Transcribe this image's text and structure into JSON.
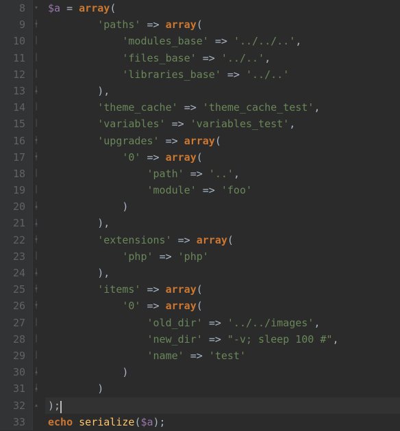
{
  "lines": [
    {
      "num": "8",
      "folds": [
        "open"
      ],
      "tokens": [
        "var:$a",
        " ",
        "punct:= ",
        "kw:array",
        "punct:("
      ]
    },
    {
      "num": "9",
      "folds": [
        "bar",
        "open"
      ],
      "tokens": [
        "indent:8",
        "str:'paths'",
        " ",
        "arrow:=>",
        " ",
        "kw:array",
        "punct:("
      ]
    },
    {
      "num": "10",
      "folds": [
        "bar",
        "bar"
      ],
      "tokens": [
        "indent:12",
        "str:'modules_base'",
        " ",
        "arrow:=>",
        " ",
        "str:'../../..'",
        "punct:,"
      ]
    },
    {
      "num": "11",
      "folds": [
        "bar",
        "bar"
      ],
      "tokens": [
        "indent:12",
        "str:'files_base'",
        " ",
        "arrow:=>",
        " ",
        "str:'../..'",
        "punct:,"
      ]
    },
    {
      "num": "12",
      "folds": [
        "bar",
        "bar"
      ],
      "tokens": [
        "indent:12",
        "str:'libraries_base'",
        " ",
        "arrow:=>",
        " ",
        "str:'../..'"
      ]
    },
    {
      "num": "13",
      "folds": [
        "bar",
        "close"
      ],
      "tokens": [
        "indent:8",
        "punct:)",
        "punct:,"
      ]
    },
    {
      "num": "14",
      "folds": [
        "bar"
      ],
      "tokens": [
        "indent:8",
        "str:'theme_cache'",
        " ",
        "arrow:=>",
        " ",
        "str:'theme_cache_test'",
        "punct:,"
      ]
    },
    {
      "num": "15",
      "folds": [
        "bar"
      ],
      "tokens": [
        "indent:8",
        "str:'variables'",
        " ",
        "arrow:=>",
        " ",
        "str:'variables_test'",
        "punct:,"
      ]
    },
    {
      "num": "16",
      "folds": [
        "bar",
        "open"
      ],
      "tokens": [
        "indent:8",
        "str:'upgrades'",
        " ",
        "arrow:=>",
        " ",
        "kw:array",
        "punct:("
      ]
    },
    {
      "num": "17",
      "folds": [
        "bar",
        "open"
      ],
      "tokens": [
        "indent:12",
        "str:'0'",
        " ",
        "arrow:=>",
        " ",
        "kw:array",
        "punct:("
      ]
    },
    {
      "num": "18",
      "folds": [
        "bar",
        "bar"
      ],
      "tokens": [
        "indent:16",
        "str:'path'",
        " ",
        "arrow:=>",
        " ",
        "str:'..'",
        "punct:,"
      ]
    },
    {
      "num": "19",
      "folds": [
        "bar",
        "bar"
      ],
      "tokens": [
        "indent:16",
        "str:'module'",
        " ",
        "arrow:=>",
        " ",
        "str:'foo'"
      ]
    },
    {
      "num": "20",
      "folds": [
        "bar",
        "close"
      ],
      "tokens": [
        "indent:12",
        "punct:)"
      ]
    },
    {
      "num": "21",
      "folds": [
        "bar",
        "close"
      ],
      "tokens": [
        "indent:8",
        "punct:)",
        "punct:,"
      ]
    },
    {
      "num": "22",
      "folds": [
        "bar",
        "open"
      ],
      "tokens": [
        "indent:8",
        "str:'extensions'",
        " ",
        "arrow:=>",
        " ",
        "kw:array",
        "punct:("
      ]
    },
    {
      "num": "23",
      "folds": [
        "bar",
        "bar"
      ],
      "tokens": [
        "indent:12",
        "str:'php'",
        " ",
        "arrow:=>",
        " ",
        "str:'php'"
      ]
    },
    {
      "num": "24",
      "folds": [
        "bar",
        "close"
      ],
      "tokens": [
        "indent:8",
        "punct:)",
        "punct:,"
      ]
    },
    {
      "num": "25",
      "folds": [
        "bar",
        "open"
      ],
      "tokens": [
        "indent:8",
        "str:'items'",
        " ",
        "arrow:=>",
        " ",
        "kw:array",
        "punct:("
      ]
    },
    {
      "num": "26",
      "folds": [
        "bar",
        "open"
      ],
      "tokens": [
        "indent:12",
        "str:'0'",
        " ",
        "arrow:=>",
        " ",
        "kw:array",
        "punct:("
      ]
    },
    {
      "num": "27",
      "folds": [
        "bar",
        "bar"
      ],
      "tokens": [
        "indent:16",
        "str:'old_dir'",
        " ",
        "arrow:=>",
        " ",
        "str:'../../images'",
        "punct:,"
      ]
    },
    {
      "num": "28",
      "folds": [
        "bar",
        "bar"
      ],
      "tokens": [
        "indent:16",
        "str:'new_dir'",
        " ",
        "arrow:=>",
        " ",
        "str:\"-v; sleep 100 #\"",
        "punct:,"
      ]
    },
    {
      "num": "29",
      "folds": [
        "bar",
        "bar"
      ],
      "tokens": [
        "indent:16",
        "str:'name'",
        " ",
        "arrow:=>",
        " ",
        "str:'test'"
      ]
    },
    {
      "num": "30",
      "folds": [
        "bar",
        "close"
      ],
      "tokens": [
        "indent:12",
        "punct:)"
      ]
    },
    {
      "num": "31",
      "folds": [
        "bar",
        "close"
      ],
      "tokens": [
        "indent:8",
        "punct:)"
      ]
    },
    {
      "num": "32",
      "folds": [
        "close"
      ],
      "hl": true,
      "tokens": [
        "punct:);",
        "caret:"
      ]
    },
    {
      "num": "33",
      "folds": [],
      "tokens": [
        "kw:echo",
        " ",
        "func:serialize",
        "punct:(",
        "var:$a",
        "punct:);"
      ]
    }
  ]
}
